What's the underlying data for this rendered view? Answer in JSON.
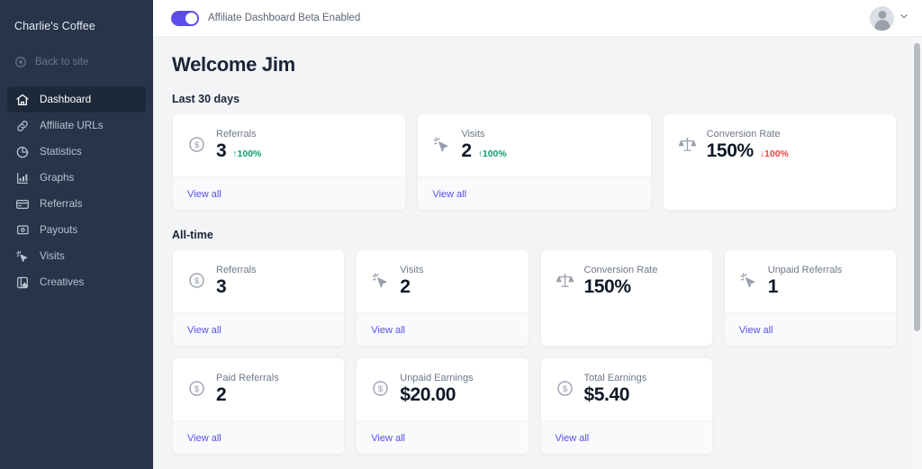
{
  "sidebar": {
    "brand": "Charlie's Coffee",
    "back_to_site": "Back to site",
    "items": [
      {
        "label": "Dashboard",
        "icon": "home-icon",
        "active": true
      },
      {
        "label": "Affiliate URLs",
        "icon": "link-icon",
        "active": false
      },
      {
        "label": "Statistics",
        "icon": "pie-chart-icon",
        "active": false
      },
      {
        "label": "Graphs",
        "icon": "bar-chart-icon",
        "active": false
      },
      {
        "label": "Referrals",
        "icon": "credit-card-icon",
        "active": false
      },
      {
        "label": "Payouts",
        "icon": "money-icon",
        "active": false
      },
      {
        "label": "Visits",
        "icon": "click-cursor-icon",
        "active": false
      },
      {
        "label": "Creatives",
        "icon": "image-icon",
        "active": false
      }
    ]
  },
  "topbar": {
    "toggle_label": "Affiliate Dashboard Beta Enabled",
    "toggle_enabled": true,
    "chevron": "⌄"
  },
  "main": {
    "page_title": "Welcome Jim",
    "section_last30": "Last 30 days",
    "section_alltime": "All-time",
    "view_all": "View all",
    "last30_cards": [
      {
        "label": "Referrals",
        "value": "3",
        "icon": "dollar-circle-icon",
        "delta": "↑100%",
        "delta_dir": "up",
        "has_footer": true
      },
      {
        "label": "Visits",
        "value": "2",
        "icon": "click-cursor-icon",
        "delta": "↑100%",
        "delta_dir": "up",
        "has_footer": true
      },
      {
        "label": "Conversion Rate",
        "value": "150%",
        "icon": "scales-icon",
        "delta": "↓100%",
        "delta_dir": "down",
        "has_footer": false
      }
    ],
    "alltime_cards_row1": [
      {
        "label": "Referrals",
        "value": "3",
        "icon": "dollar-circle-icon",
        "has_footer": true
      },
      {
        "label": "Visits",
        "value": "2",
        "icon": "click-cursor-icon",
        "has_footer": true
      },
      {
        "label": "Conversion Rate",
        "value": "150%",
        "icon": "scales-icon",
        "has_footer": false
      },
      {
        "label": "Unpaid Referrals",
        "value": "1",
        "icon": "click-cursor-icon",
        "has_footer": true
      }
    ],
    "alltime_cards_row2": [
      {
        "label": "Paid Referrals",
        "value": "2",
        "icon": "dollar-circle-icon",
        "has_footer": true
      },
      {
        "label": "Unpaid Earnings",
        "value": "$20.00",
        "icon": "dollar-circle-icon",
        "has_footer": true
      },
      {
        "label": "Total Earnings",
        "value": "$5.40",
        "icon": "dollar-circle-icon",
        "has_footer": true
      }
    ]
  },
  "colors": {
    "sidebar_bg": "#27344a",
    "accent": "#5b4ee8",
    "up": "#0f9d6e",
    "down": "#ef4444",
    "page_bg": "#f3f4f6"
  }
}
